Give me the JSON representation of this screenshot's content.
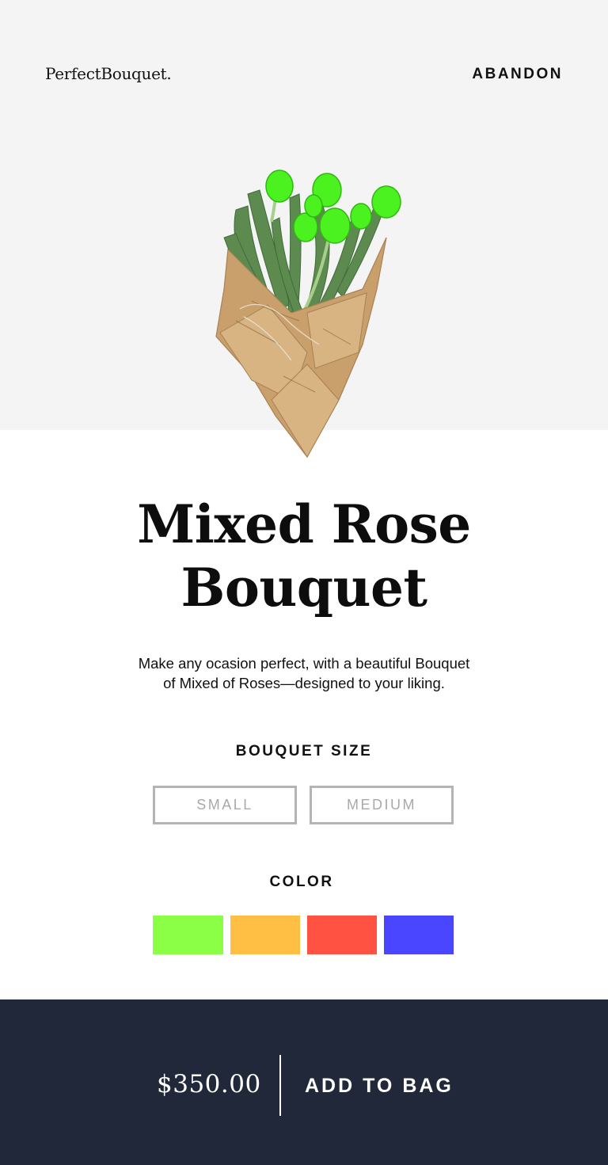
{
  "header": {
    "brand": "PerfectBouquet.",
    "abandon_label": "ABANDON"
  },
  "product": {
    "title_line1": "Mixed Rose",
    "title_line2": "Bouquet",
    "description_line1": "Make any ocasion perfect, with a beautiful Bouquet",
    "description_line2": "of Mixed of Roses—designed to your liking."
  },
  "size": {
    "label": "BOUQUET SIZE",
    "options": [
      "SMALL",
      "MEDIUM"
    ]
  },
  "color": {
    "label": "COLOR",
    "swatches": [
      "#8aff45",
      "#ffbe44",
      "#ff5243",
      "#4a46ff"
    ]
  },
  "footer": {
    "price": "$350.00",
    "add_label": "ADD TO BAG"
  },
  "colors": {
    "hero_bg": "#f4f4f4",
    "footer_bg": "#20283a",
    "flower": "#4cf21f"
  }
}
